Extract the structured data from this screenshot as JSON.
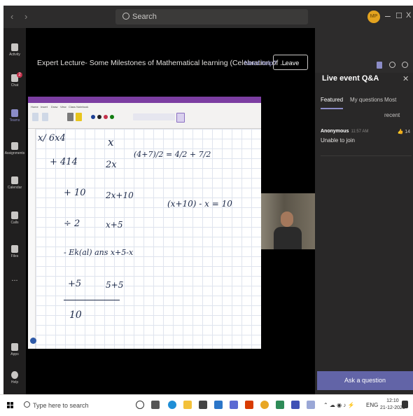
{
  "window": {
    "nav_arrows": "‹ ›",
    "search_placeholder": "Search",
    "avatar_initials": "MP",
    "controls": [
      "–",
      "☐",
      "X"
    ]
  },
  "rail": [
    {
      "label": "Activity",
      "icon": "bell-icon"
    },
    {
      "label": "Chat",
      "icon": "chat-icon",
      "badge": "2"
    },
    {
      "label": "Teams",
      "icon": "teams-icon",
      "active": true
    },
    {
      "label": "Assignments",
      "icon": "assignments-icon"
    },
    {
      "label": "Calendar",
      "icon": "calendar-icon"
    },
    {
      "label": "Calls",
      "icon": "phone-icon"
    },
    {
      "label": "Files",
      "icon": "files-icon"
    },
    {
      "label": "...",
      "icon": "more-icon"
    },
    {
      "label": "Apps",
      "icon": "apps-icon"
    },
    {
      "label": "Help",
      "icon": "help-icon"
    }
  ],
  "meeting": {
    "title": "Expert Lecture- Some Milestones of Mathematical learning (Celebration of ...",
    "need_help": "Need help?",
    "leave": "Leave"
  },
  "onenote": {
    "tabs": [
      "Home",
      "Insert",
      "Draw",
      "View",
      "Class Notebook"
    ],
    "handwriting": [
      {
        "text": "x/ 6x4",
        "pos": "a"
      },
      {
        "text": "x",
        "pos": "b"
      },
      {
        "text": "(4+7)/2 = 4/2 + 7/2",
        "pos": "c"
      },
      {
        "text": "+ 414",
        "pos": "d"
      },
      {
        "text": "2x",
        "pos": "e"
      },
      {
        "text": "+ 10",
        "pos": "f"
      },
      {
        "text": "2x+10",
        "pos": "g"
      },
      {
        "text": "(x+10) - x = 10",
        "pos": "h"
      },
      {
        "text": "÷ 2",
        "pos": "i"
      },
      {
        "text": "x+5",
        "pos": "j"
      },
      {
        "text": "- Ek(al) ans  x+5-x",
        "pos": "k"
      },
      {
        "text": "+5",
        "pos": "l"
      },
      {
        "text": "5+5",
        "pos": "m"
      },
      {
        "text": "10",
        "pos": "n"
      }
    ]
  },
  "panel": {
    "title": "Live event Q&A",
    "tabs": [
      "Featured",
      "My questions",
      "Most recent"
    ],
    "questions": [
      {
        "author": "Anonymous",
        "time": "11:57 AM",
        "text": "Unable to join",
        "likes": "14"
      }
    ],
    "ask_button": "Ask a question"
  },
  "taskbar": {
    "search_placeholder": "Type here to search",
    "lang": "ENG",
    "time": "12:10",
    "date": "21-12-2020"
  },
  "colors": {
    "accent": "#6264a7",
    "onenote": "#7c3ea2",
    "badge": "#c4314b"
  }
}
